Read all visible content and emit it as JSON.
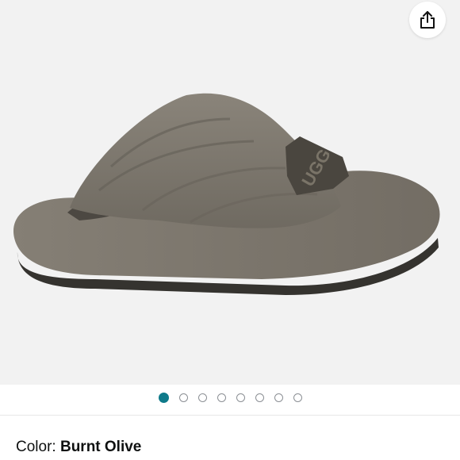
{
  "product": {
    "image_icon": "ugg-fluff-slide-slipper",
    "color_label": "Color: ",
    "color_value": "Burnt Olive"
  },
  "toolbar": {
    "share_icon": "share-icon"
  },
  "carousel": {
    "total_images": 8,
    "active_index": 0,
    "active_color": "#0f7a8a"
  },
  "colors": {
    "fur": "#7b756b",
    "sole": "#3a3835",
    "strap": "#4b4740",
    "background": "#f2f2f2"
  },
  "logo_text": "UGG"
}
